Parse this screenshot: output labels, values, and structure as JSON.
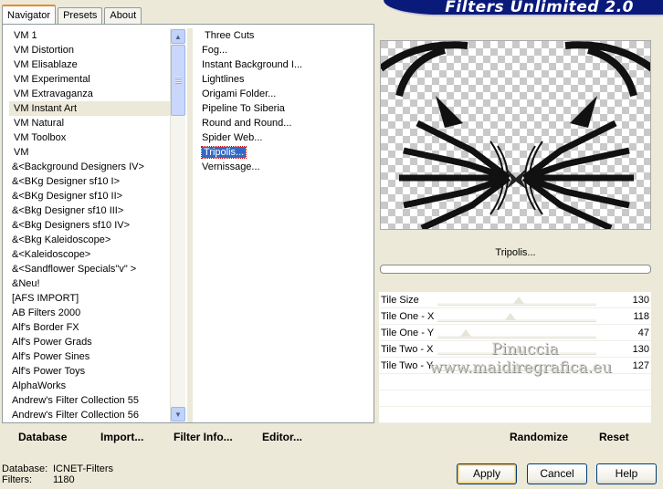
{
  "tabs": [
    {
      "label": "Navigator",
      "active": true
    },
    {
      "label": "Presets",
      "active": false
    },
    {
      "label": "About",
      "active": false
    }
  ],
  "banner": "Filters Unlimited 2.0",
  "categories": [
    {
      "label": "VM 1"
    },
    {
      "label": "VM Distortion"
    },
    {
      "label": "VM Elisablaze"
    },
    {
      "label": "VM Experimental"
    },
    {
      "label": "VM Extravaganza"
    },
    {
      "label": "VM Instant Art",
      "selected": true
    },
    {
      "label": "VM Natural"
    },
    {
      "label": "VM Toolbox"
    },
    {
      "label": "VM"
    },
    {
      "label": "&<Background Designers IV>"
    },
    {
      "label": "&<BKg Designer sf10 I>"
    },
    {
      "label": "&<BKg Designer sf10 II>"
    },
    {
      "label": "&<Bkg Designer sf10 III>"
    },
    {
      "label": "&<Bkg Designers sf10 IV>"
    },
    {
      "label": "&<Bkg Kaleidoscope>"
    },
    {
      "label": "&<Kaleidoscope>"
    },
    {
      "label": "&<Sandflower Specials\"v\" >"
    },
    {
      "label": "&Neu!"
    },
    {
      "label": "[AFS IMPORT]"
    },
    {
      "label": "AB Filters 2000"
    },
    {
      "label": "Alf's Border FX"
    },
    {
      "label": "Alf's Power Grads"
    },
    {
      "label": "Alf's Power Sines"
    },
    {
      "label": "Alf's Power Toys"
    },
    {
      "label": "AlphaWorks"
    },
    {
      "label": "Andrew's Filter Collection 55"
    },
    {
      "label": "Andrew's Filter Collection 56"
    }
  ],
  "filters": [
    {
      "label": "Three Cuts"
    },
    {
      "label": "Fog..."
    },
    {
      "label": "Instant Background I..."
    },
    {
      "label": "Lightlines"
    },
    {
      "label": "Origami Folder..."
    },
    {
      "label": "Pipeline To Siberia"
    },
    {
      "label": "Round and Round..."
    },
    {
      "label": "Spider Web..."
    },
    {
      "label": "Tripolis...",
      "selected": true
    },
    {
      "label": "Vernissage..."
    }
  ],
  "filter_name": "Tripolis...",
  "parameters": [
    {
      "label": "Tile Size",
      "value": "130",
      "position": 0.51
    },
    {
      "label": "Tile One - X",
      "value": "118",
      "position": 0.46
    },
    {
      "label": "Tile One - Y",
      "value": "47",
      "position": 0.18
    },
    {
      "label": "Tile Two - X",
      "value": "130",
      "position": 0.51
    },
    {
      "label": "Tile Two - Y",
      "value": "127",
      "position": 0.5
    }
  ],
  "watermark": {
    "line1": "Pinuccia",
    "line2": "www.maidiregrafica.eu"
  },
  "toolbar": {
    "database": "Database",
    "import": "Import...",
    "filter_info": "Filter Info...",
    "editor": "Editor...",
    "randomize": "Randomize",
    "reset": "Reset"
  },
  "status": {
    "database_label": "Database:",
    "database_value": "ICNET-Filters",
    "filters_label": "Filters:",
    "filters_value": "1180"
  },
  "buttons": {
    "apply": "Apply",
    "cancel": "Cancel",
    "help": "Help"
  }
}
